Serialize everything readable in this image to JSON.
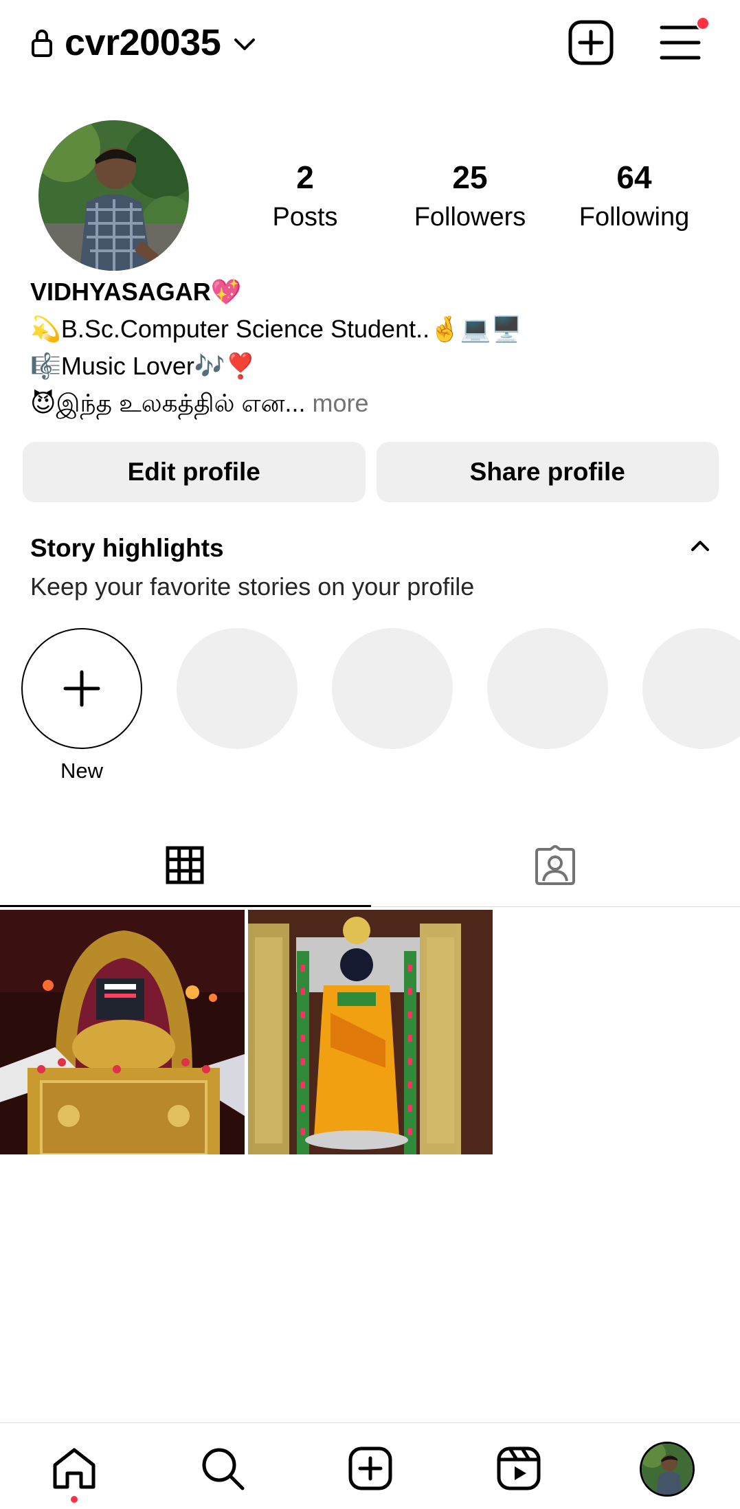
{
  "header": {
    "username": "cvr20035",
    "icons": [
      "lock-icon",
      "chevron-down-icon",
      "create-icon",
      "menu-icon"
    ],
    "notification_dot_color": "#ff3040"
  },
  "profile": {
    "stats": [
      {
        "value": "2",
        "label": "Posts"
      },
      {
        "value": "25",
        "label": "Followers"
      },
      {
        "value": "64",
        "label": "Following"
      }
    ],
    "bio": {
      "name": "VIDHYASAGAR💖",
      "lines": [
        "💫B.Sc.Computer Science Student..🤞💻🖥️",
        "🎼Music Lover🎶❣️",
        "😈இந்த உலகத்தில் என..."
      ],
      "more": " more"
    },
    "buttons": {
      "edit": "Edit profile",
      "share": "Share profile"
    }
  },
  "highlights": {
    "title": "Story highlights",
    "subtitle": "Keep your favorite stories on your profile",
    "new_label": "New",
    "placeholder_count": 4
  },
  "tabs": {
    "items": [
      "grid-icon",
      "tagged-icon"
    ],
    "active": "grid"
  },
  "posts": [
    {
      "name": "post-temple-lingam"
    },
    {
      "name": "post-temple-goddess"
    }
  ],
  "bottom_nav": {
    "items": [
      "home-icon",
      "search-icon",
      "create-post-icon",
      "reels-icon",
      "profile-avatar"
    ],
    "active": "home"
  },
  "colors": {
    "button_bg": "#efefef",
    "divider": "#dbdbdb",
    "muted_text": "#737373",
    "accent_red": "#ff3040"
  }
}
